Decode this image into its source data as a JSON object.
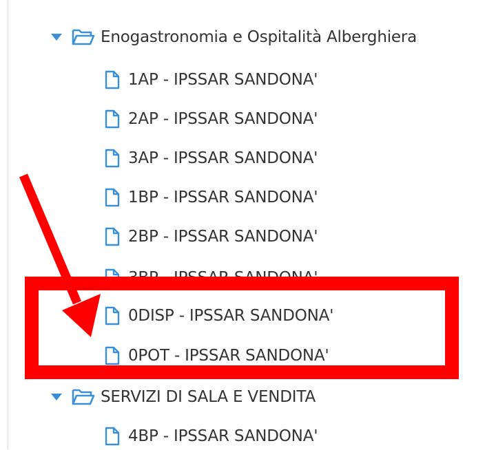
{
  "tree": {
    "folders": [
      {
        "label": "Enogastronomia e Ospitalità Alberghiera",
        "expanded": true
      },
      {
        "label": "SERVIZI DI SALA E VENDITA",
        "expanded": true
      }
    ],
    "files": [
      {
        "label": "1AP - IPSSAR SANDONA'"
      },
      {
        "label": "2AP - IPSSAR SANDONA'"
      },
      {
        "label": "3AP - IPSSAR SANDONA'"
      },
      {
        "label": "1BP - IPSSAR SANDONA'"
      },
      {
        "label": "2BP - IPSSAR SANDONA'"
      },
      {
        "label": "3BP - IPSSAR SANDONA'"
      },
      {
        "label": "0DISP - IPSSAR SANDONA'"
      },
      {
        "label": "0POT - IPSSAR SANDONA'"
      },
      {
        "label": "4BP - IPSSAR SANDONA'"
      }
    ]
  },
  "colors": {
    "icon_blue": "#3a8fd6",
    "text": "#333333",
    "annotation_red": "#ff0000",
    "rule_gray": "#d9d9d9"
  },
  "icons": {
    "caret": "caret-down-icon",
    "folder": "folder-open-icon",
    "file": "file-icon"
  }
}
